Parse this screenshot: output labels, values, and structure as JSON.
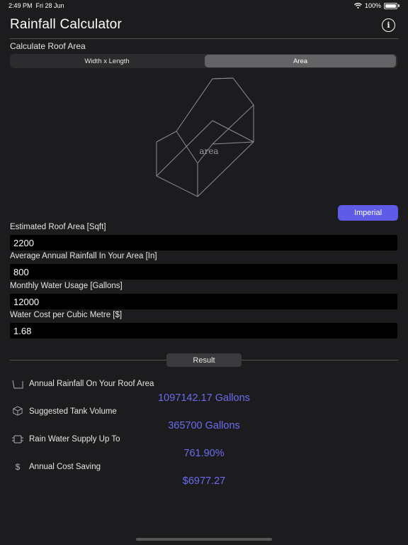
{
  "status": {
    "time": "2:49 PM",
    "date": "Fri 28 Jun",
    "battery": "100%"
  },
  "header": {
    "title": "Rainfall Calculator",
    "info_icon": "info-circle-icon"
  },
  "roof": {
    "section_label": "Calculate Roof Area",
    "segments": [
      "Width x Length",
      "Area"
    ],
    "selected_segment": "Area",
    "diagram_label": "area"
  },
  "units_button": "Imperial",
  "fields": [
    {
      "label": "Estimated Roof Area [Sqft]",
      "value": "2200"
    },
    {
      "label": "Average Annual Rainfall In Your Area [In]",
      "value": "800"
    },
    {
      "label": "Monthly Water Usage [Gallons]",
      "value": "12000"
    },
    {
      "label": "Water Cost per Cubic Metre [$]",
      "value": "1.68"
    }
  ],
  "result_button": "Result",
  "results": [
    {
      "icon": "roof-tray-icon",
      "label": "Annual Rainfall On Your Roof Area",
      "value": "1097142.17 Gallons"
    },
    {
      "icon": "cube-icon",
      "label": "Suggested Tank Volume",
      "value": "365700 Gallons"
    },
    {
      "icon": "tank-icon",
      "label": "Rain Water Supply Up To",
      "value": "761.90%"
    },
    {
      "icon": "dollar-icon",
      "label": "Annual Cost Saving",
      "value": "$6977.27"
    }
  ],
  "colors": {
    "accent": "#5e5ce6",
    "result_text": "#6d6bf0",
    "background": "#1c1c1e"
  }
}
